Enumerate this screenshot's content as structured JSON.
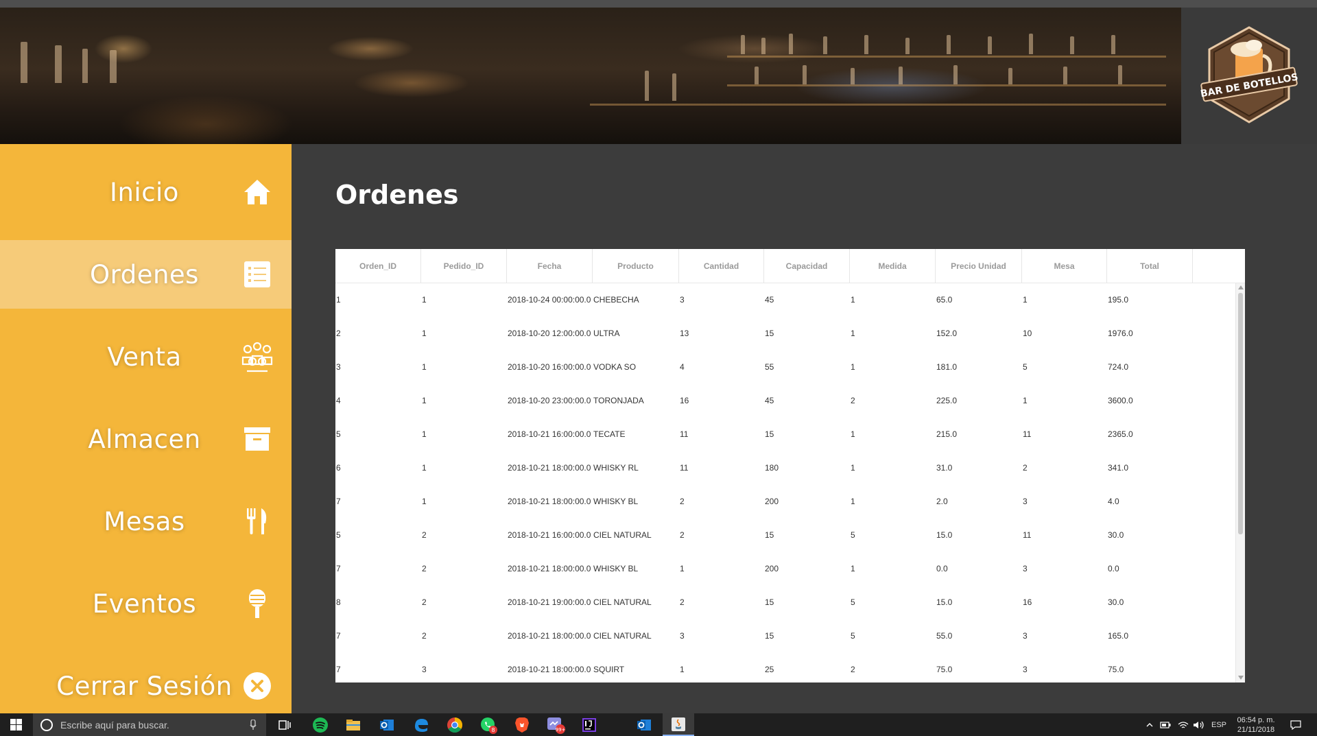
{
  "window": {
    "title": ""
  },
  "brand": {
    "logo_text": "BAR DE BOTELLOS"
  },
  "sidebar": {
    "items": [
      {
        "label": "Inicio",
        "icon": "home-icon",
        "active": false
      },
      {
        "label": "Ordenes",
        "icon": "list-icon",
        "active": true
      },
      {
        "label": "Venta",
        "icon": "people-icon",
        "active": false
      },
      {
        "label": "Almacen",
        "icon": "archive-box-icon",
        "active": false
      },
      {
        "label": "Mesas",
        "icon": "fork-knife-icon",
        "active": false
      },
      {
        "label": "Eventos",
        "icon": "microphone-icon",
        "active": false
      },
      {
        "label": "Cerrar Sesión",
        "icon": "close-circle-icon",
        "active": false
      }
    ]
  },
  "main": {
    "title": "Ordenes",
    "table": {
      "columns": [
        "Orden_ID",
        "Pedido_ID",
        "Fecha",
        "Producto",
        "Cantidad",
        "Capacidad",
        "Medida",
        "Precio Unidad",
        "Mesa",
        "Total"
      ],
      "rows": [
        [
          "1",
          "1",
          "2018-10-24 00:00:00.0",
          "CHEBECHA",
          "3",
          "45",
          "1",
          "65.0",
          "1",
          "195.0"
        ],
        [
          "2",
          "1",
          "2018-10-20 12:00:00.0",
          "ULTRA",
          "13",
          "15",
          "1",
          "152.0",
          "10",
          "1976.0"
        ],
        [
          "3",
          "1",
          "2018-10-20 16:00:00.0",
          "VODKA SO",
          "4",
          "55",
          "1",
          "181.0",
          "5",
          "724.0"
        ],
        [
          "4",
          "1",
          "2018-10-20 23:00:00.0",
          "TORONJADA",
          "16",
          "45",
          "2",
          "225.0",
          "1",
          "3600.0"
        ],
        [
          "5",
          "1",
          "2018-10-21 16:00:00.0",
          "TECATE",
          "11",
          "15",
          "1",
          "215.0",
          "11",
          "2365.0"
        ],
        [
          "6",
          "1",
          "2018-10-21 18:00:00.0",
          "WHISKY RL",
          "11",
          "180",
          "1",
          "31.0",
          "2",
          "341.0"
        ],
        [
          "7",
          "1",
          "2018-10-21 18:00:00.0",
          "WHISKY BL",
          "2",
          "200",
          "1",
          "2.0",
          "3",
          "4.0"
        ],
        [
          "5",
          "2",
          "2018-10-21 16:00:00.0",
          "CIEL NATURAL",
          "2",
          "15",
          "5",
          "15.0",
          "11",
          "30.0"
        ],
        [
          "7",
          "2",
          "2018-10-21 18:00:00.0",
          "WHISKY BL",
          "1",
          "200",
          "1",
          "0.0",
          "3",
          "0.0"
        ],
        [
          "8",
          "2",
          "2018-10-21 19:00:00.0",
          "CIEL NATURAL",
          "2",
          "15",
          "5",
          "15.0",
          "16",
          "30.0"
        ],
        [
          "7",
          "2",
          "2018-10-21 18:00:00.0",
          "CIEL NATURAL",
          "3",
          "15",
          "5",
          "55.0",
          "3",
          "165.0"
        ],
        [
          "7",
          "3",
          "2018-10-21 18:00:00.0",
          "SQUIRT",
          "1",
          "25",
          "2",
          "75.0",
          "3",
          "75.0"
        ]
      ]
    }
  },
  "taskbar": {
    "search_placeholder": "Escribe aquí para buscar.",
    "language": "ESP",
    "time": "06:54 p. m.",
    "date": "21/11/2018",
    "apps": [
      "task-view-icon",
      "spotify-icon",
      "file-explorer-icon",
      "outlook-icon",
      "edge-icon",
      "chrome-icon",
      "whatsapp-icon",
      "brave-icon",
      "messenger-icon",
      "intellij-icon",
      "outlook-icon",
      "java-icon"
    ],
    "badges": {
      "whatsapp": "8",
      "messenger": "99+"
    }
  },
  "colors": {
    "sidebar": "#f4b63a",
    "sidebar_active": "#f6cb79",
    "main_bg": "#3c3c3c",
    "taskbar": "#1f1f1f"
  }
}
